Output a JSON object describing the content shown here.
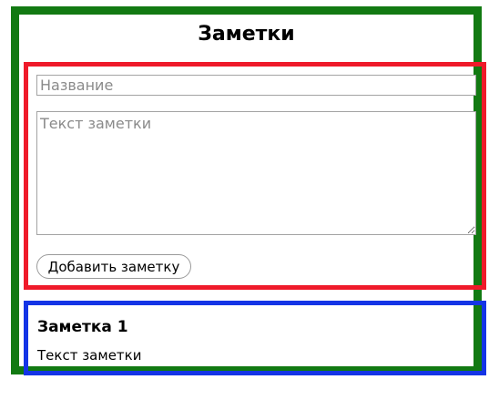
{
  "header": {
    "title": "Заметки"
  },
  "form": {
    "title_placeholder": "Название",
    "title_value": "",
    "text_placeholder": "Текст заметки",
    "text_value": "",
    "add_button_label": "Добавить заметку"
  },
  "notes": [
    {
      "title": "Заметка 1",
      "text": "Текст заметки"
    }
  ],
  "colors": {
    "app_border": "#127a12",
    "form_border": "#ef1a2a",
    "note_border": "#1434e6"
  }
}
